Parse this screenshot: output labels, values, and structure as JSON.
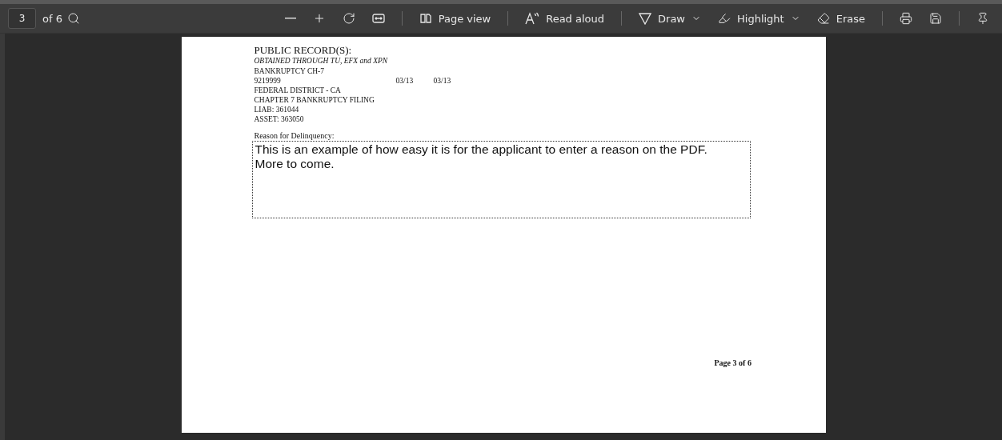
{
  "toolbar": {
    "page_input": {
      "value": "3"
    },
    "page_total": "of 6",
    "page_view": "Page view",
    "read_aloud": "Read aloud",
    "draw": "Draw",
    "highlight": "Highlight",
    "erase": "Erase"
  },
  "document": {
    "heading": "PUBLIC RECORD(S):",
    "subheading": "OBTAINED THROUGH TU, EFX and XPN",
    "rows": [
      {
        "cells": [
          "BANKRUPTCY CH-7"
        ]
      },
      {
        "cells": [
          "9219999",
          "03/13",
          "03/13"
        ]
      },
      {
        "cells": [
          "FEDERAL DISTRICT - CA"
        ]
      },
      {
        "cells": [
          "CHAPTER 7 BANKRUPTCY FILING"
        ]
      },
      {
        "cells": [
          "LIAB: 361044"
        ]
      },
      {
        "cells": [
          "ASSET: 363050"
        ]
      }
    ],
    "reason_label": "Reason for Delinquency:",
    "reason_field": {
      "lines": [
        "This is an example of how easy it is for the applicant to enter a reason on the PDF.",
        "More to come."
      ]
    },
    "footer": "Page 3 of 6"
  }
}
